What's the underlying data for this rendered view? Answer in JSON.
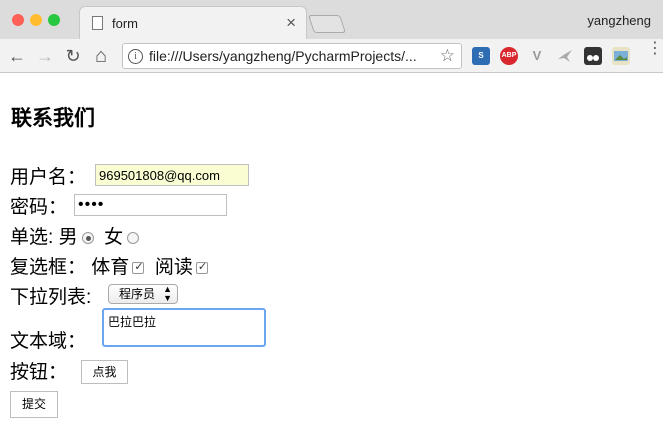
{
  "browser": {
    "tab_title": "form",
    "tab_close": "×",
    "user": "yangzheng",
    "url": "file:///Users/yangzheng/PycharmProjects/...",
    "info_icon": "i",
    "back_icon": "←",
    "forward_icon": "→",
    "reload_icon": "↻",
    "home_icon": "⌂",
    "star_icon": "☆",
    "menu_icon": "⋮",
    "ext_s": "S",
    "ext_abp": "ABP",
    "ext_v": "V"
  },
  "page": {
    "heading": "联系我们",
    "username_label": "用户名：",
    "username_value": "969501808@qq.com",
    "password_label": "密码：",
    "password_value": "••••",
    "radio_label": "单选:",
    "radio_male": "男",
    "radio_female": "女",
    "checkbox_label": "复选框：",
    "checkbox_sport": "体育",
    "checkbox_reading": "阅读",
    "dropdown_label": "下拉列表:",
    "dropdown_value": "程序员",
    "dropdown_arrows": "▲▼",
    "textarea_label": "文本域：",
    "textarea_value": "巴拉巴拉",
    "button_label": "按钮：",
    "button_text": "点我",
    "submit_text": "提交"
  },
  "colors": {
    "autofill_bg": "#fafdd2",
    "focus_border": "#6aa7f0",
    "light_red": "#fe5f57",
    "light_yellow": "#febc2e",
    "light_green": "#28c840"
  }
}
